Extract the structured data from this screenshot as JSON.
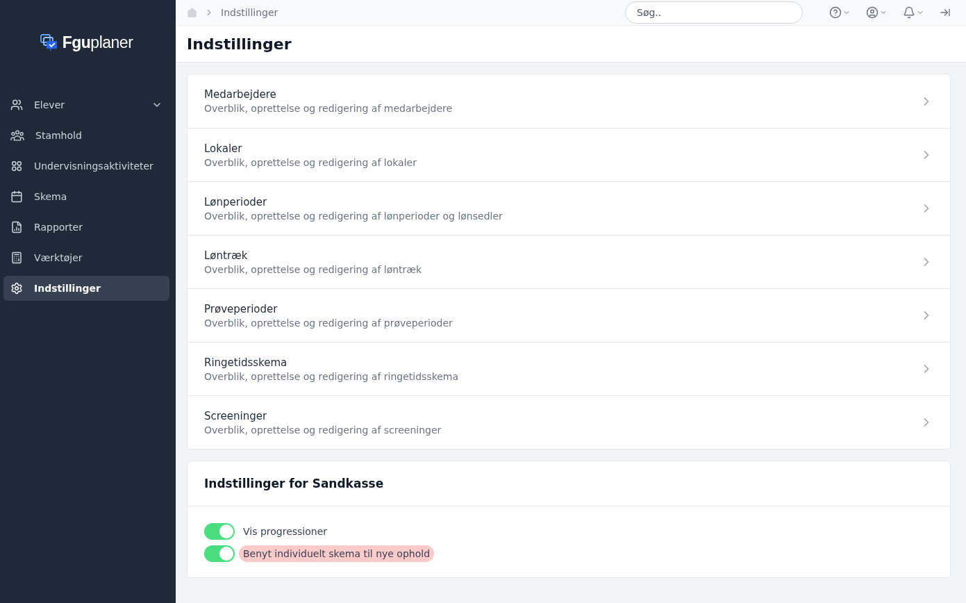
{
  "sidebar": {
    "logo": "**Fgu**planer",
    "items": [
      {
        "label": "Elever",
        "selected": false,
        "expandable": true
      },
      {
        "label": "Stamhold",
        "selected": false,
        "expandable": false
      },
      {
        "label": "Undervisningsaktiviteter",
        "selected": false,
        "expandable": false
      },
      {
        "label": "Skema",
        "selected": false,
        "expandable": false
      },
      {
        "label": "Rapporter",
        "selected": false,
        "expandable": false
      },
      {
        "label": "Værktøjer",
        "selected": false,
        "expandable": false
      },
      {
        "label": "Indstillinger",
        "selected": true,
        "expandable": false
      }
    ]
  },
  "topbar": {
    "breadcrumb": "Indstillinger",
    "search": {
      "placeholder": "Søg.."
    }
  },
  "page_title": "Indstillinger",
  "settings_list": [
    {
      "title": "Medarbejdere",
      "description": "Overblik, oprettelse og redigering af medarbejdere"
    },
    {
      "title": "Lokaler",
      "description": "Overblik, oprettelse og redigering af lokaler"
    },
    {
      "title": "Lønperioder",
      "description": "Overblik, oprettelse og redigering af lønperioder og lønsedler"
    },
    {
      "title": "Løntræk",
      "description": "Overblik, oprettelse og redigering af løntræk"
    },
    {
      "title": "Prøveperioder",
      "description": "Overblik, oprettelse og redigering af prøveperioder"
    },
    {
      "title": "Ringetidsskema",
      "description": "Overblik, oprettelse og redigering af ringetidsskema"
    },
    {
      "title": "Screeninger",
      "description": "Overblik, oprettelse og redigering af screeninger"
    }
  ],
  "sandbox": {
    "title": "Indstillinger for Sandkasse",
    "toggles": [
      {
        "label": "Vis progressioner",
        "on": true,
        "highlighted": false
      },
      {
        "label": "Benyt individuelt skema til nye ophold",
        "on": true,
        "highlighted": true
      }
    ]
  }
}
